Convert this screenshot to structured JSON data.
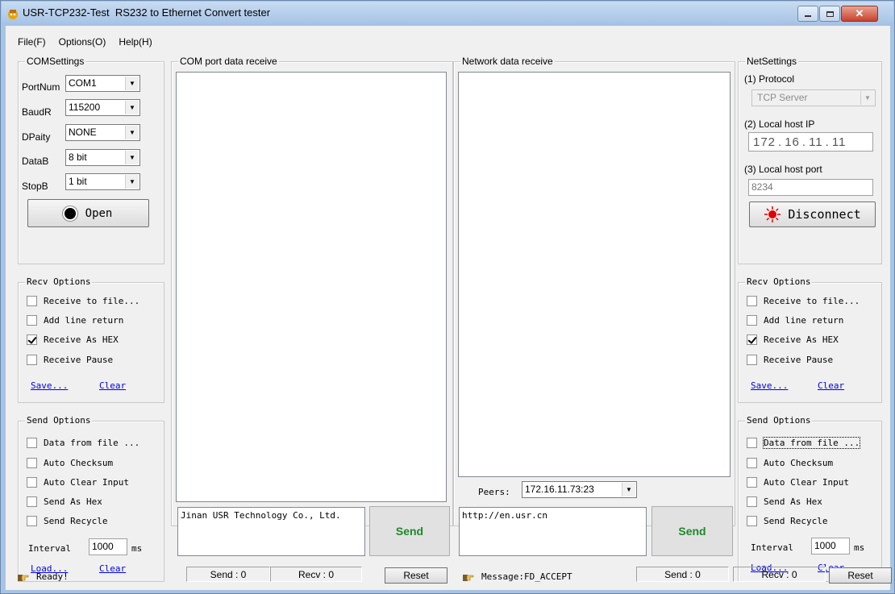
{
  "window": {
    "title": "USR-TCP232-Test  RS232 to Ethernet Convert tester"
  },
  "menu": [
    "File(F)",
    "Options(O)",
    "Help(H)"
  ],
  "com_settings": {
    "title": "COMSettings",
    "portnum_label": "PortNum",
    "portnum_value": "COM1",
    "baud_label": "BaudR",
    "baud_value": "115200",
    "parity_label": "DPaity",
    "parity_value": "NONE",
    "databits_label": "DataB",
    "databits_value": "8 bit",
    "stopbits_label": "StopB",
    "stopbits_value": "1 bit",
    "open_label": "Open"
  },
  "com_recv_options": {
    "title": "Recv Options",
    "items": [
      {
        "label": "Receive to file...",
        "checked": false
      },
      {
        "label": "Add line return",
        "checked": false
      },
      {
        "label": "Receive As HEX",
        "checked": true
      },
      {
        "label": "Receive Pause",
        "checked": false
      }
    ],
    "save": "Save...",
    "clear": "Clear"
  },
  "com_send_options": {
    "title": "Send Options",
    "items": [
      {
        "label": "Data from file ...",
        "checked": false
      },
      {
        "label": "Auto Checksum",
        "checked": false
      },
      {
        "label": "Auto Clear Input",
        "checked": false
      },
      {
        "label": "Send As Hex",
        "checked": false
      },
      {
        "label": "Send Recycle",
        "checked": false
      }
    ],
    "interval_label": "Interval",
    "interval_value": "1000",
    "interval_unit": "ms",
    "load": "Load...",
    "clear": "Clear"
  },
  "com_receive": {
    "title": "COM port data receive"
  },
  "net_receive": {
    "title": "Network data receive"
  },
  "com_send_text": "Jinan USR Technology Co., Ltd.",
  "net_send_text": "http://en.usr.cn",
  "send_label": "Send",
  "peers": {
    "label": "Peers:",
    "value": "172.16.11.73:23"
  },
  "net_settings": {
    "title": "NetSettings",
    "protocol_label": "(1) Protocol",
    "protocol_value": "TCP Server",
    "ip_label": "(2) Local host IP",
    "ip_parts": [
      "172",
      "16",
      "11",
      "11"
    ],
    "port_label": "(3) Local host port",
    "port_value": "8234",
    "disconnect_label": "Disconnect"
  },
  "net_recv_options": {
    "title": "Recv Options",
    "items": [
      {
        "label": "Receive to file...",
        "checked": false
      },
      {
        "label": "Add line return",
        "checked": false
      },
      {
        "label": "Receive As HEX",
        "checked": true
      },
      {
        "label": "Receive Pause",
        "checked": false
      }
    ],
    "save": "Save...",
    "clear": "Clear"
  },
  "net_send_options": {
    "title": "Send Options",
    "items": [
      {
        "label": "Data from file ...",
        "checked": false
      },
      {
        "label": "Auto Checksum",
        "checked": false
      },
      {
        "label": "Auto Clear Input",
        "checked": false
      },
      {
        "label": "Send As Hex",
        "checked": false
      },
      {
        "label": "Send Recycle",
        "checked": false
      }
    ],
    "interval_label": "Interval",
    "interval_value": "1000",
    "interval_unit": "ms",
    "load": "Load...",
    "clear": "Clear"
  },
  "status": {
    "ready": "Ready!",
    "com_send": "Send : 0",
    "com_recv": "Recv : 0",
    "reset": "Reset",
    "message": "Message:FD_ACCEPT",
    "net_send": "Send : 0",
    "net_recv": "Recv : 0"
  },
  "colors": {
    "accent_green": "#1c8a2a",
    "link_blue": "#0000ee",
    "disconnect_red": "#e00000"
  }
}
